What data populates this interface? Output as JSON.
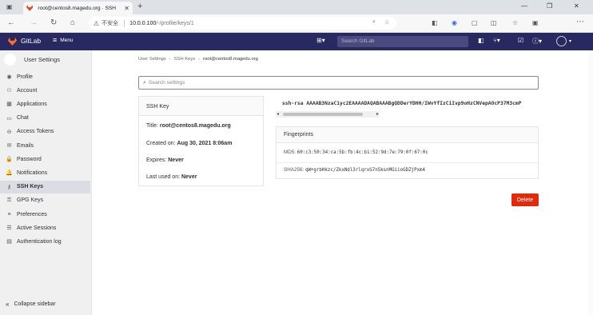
{
  "browser": {
    "tab_title": "root@centos8.magedu.org · SSH",
    "not_secure": "不安全",
    "url_host": "10.0.0.100",
    "url_path": "/-/profile/keys/1",
    "minimize": "—",
    "maximize": "❐",
    "close": "✕"
  },
  "header": {
    "brand": "GitLab",
    "menu": "Menu",
    "search_placeholder": "Search GitLab"
  },
  "sidebar": {
    "title": "User Settings",
    "items": [
      {
        "label": "Profile",
        "icon": "profile-icon",
        "glyph": "◉"
      },
      {
        "label": "Account",
        "icon": "account-icon",
        "glyph": "⚇"
      },
      {
        "label": "Applications",
        "icon": "applications-icon",
        "glyph": "▦"
      },
      {
        "label": "Chat",
        "icon": "chat-icon",
        "glyph": "▭"
      },
      {
        "label": "Access Tokens",
        "icon": "token-icon",
        "glyph": "⊖"
      },
      {
        "label": "Emails",
        "icon": "email-icon",
        "glyph": "✉"
      },
      {
        "label": "Password",
        "icon": "lock-icon",
        "glyph": "🔒"
      },
      {
        "label": "Notifications",
        "icon": "bell-icon",
        "glyph": "🔔"
      },
      {
        "label": "SSH Keys",
        "icon": "key-icon",
        "glyph": "⚷"
      },
      {
        "label": "GPG Keys",
        "icon": "gpg-key-icon",
        "glyph": "⚿"
      },
      {
        "label": "Preferences",
        "icon": "preferences-icon",
        "glyph": "≡"
      },
      {
        "label": "Active Sessions",
        "icon": "sessions-icon",
        "glyph": "☰"
      },
      {
        "label": "Authentication log",
        "icon": "log-icon",
        "glyph": "▤"
      }
    ],
    "active_index": 8,
    "collapse": "Collapse sidebar"
  },
  "breadcrumb": {
    "items": [
      "User Settings",
      "SSH Keys",
      "root@centos8.magedu.org"
    ]
  },
  "settings_search": {
    "placeholder": "Search settings"
  },
  "key_card": {
    "header": "SSH Key",
    "title_label": "Title:",
    "title_value": "root@centos8.magedu.org",
    "created_label": "Created on:",
    "created_value": "Aug 30, 2021 8:06am",
    "expires_label": "Expires:",
    "expires_value": "Never",
    "last_used_label": "Last used on:",
    "last_used_value": "Never"
  },
  "key_text": "ssh-rsa AAAAB3NzaC1yc2EAAAADAQABAAABgQDDerYDHH/IWvYfIzCiIvp9oHzCNVepAOcP37M3cmP",
  "fingerprints": {
    "header": "Fingerprints",
    "md5_label": "MD5:",
    "md5_value": "60:c3:50:34:ca:5b:fb:4c:b1:52:9d:7e:79:0f:67:0c",
    "sha256_label": "SHA256:",
    "sha256_value": "qW+grbHkzc/ZkxNdl3rlqrxG7n5ksnMGiioGDZjPxm4"
  },
  "delete_button": "Delete",
  "colors": {
    "header": "#292961",
    "delete": "#dd2b0e",
    "sidebar": "#f0f0f0"
  }
}
